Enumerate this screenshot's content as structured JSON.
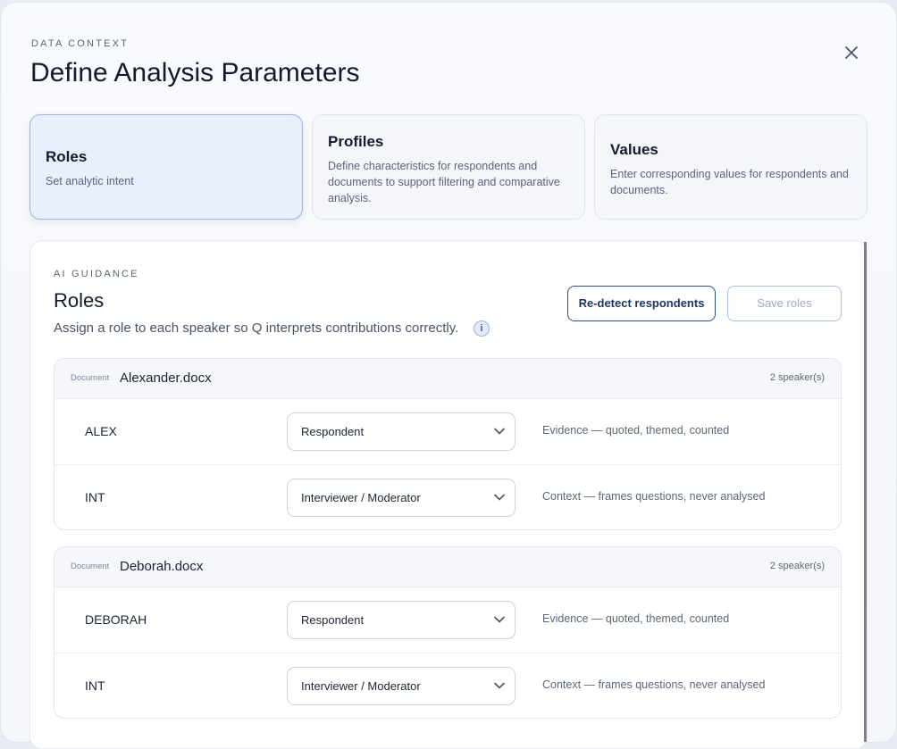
{
  "header": {
    "eyebrow": "DATA CONTEXT",
    "title": "Define Analysis Parameters",
    "close_icon": "close-icon"
  },
  "steps": [
    {
      "title": "Roles",
      "description": "Set analytic intent",
      "active": true
    },
    {
      "title": "Profiles",
      "description": "Define characteristics for respondents and documents to support filtering and comparative analysis.",
      "active": false
    },
    {
      "title": "Values",
      "description": "Enter corresponding values for respondents and documents.",
      "active": false
    }
  ],
  "panel": {
    "eyebrow": "AI GUIDANCE",
    "title": "Roles",
    "subtitle": "Assign a role to each speaker so Q interprets contributions correctly.",
    "info_icon": "i",
    "redetect_label": "Re-detect respondents",
    "save_label": "Save roles"
  },
  "documents": [
    {
      "tag": "Document",
      "name": "Alexander.docx",
      "count": "2 speaker(s)",
      "rows": [
        {
          "speaker": "ALEX",
          "role": "Respondent",
          "hint": "Evidence — quoted, themed, counted"
        },
        {
          "speaker": "INT",
          "role": "Interviewer / Moderator",
          "hint": "Context — frames questions, never analysed"
        }
      ]
    },
    {
      "tag": "Document",
      "name": "Deborah.docx",
      "count": "2 speaker(s)",
      "rows": [
        {
          "speaker": "DEBORAH",
          "role": "Respondent",
          "hint": "Evidence — quoted, themed, counted"
        },
        {
          "speaker": "INT",
          "role": "Interviewer / Moderator",
          "hint": "Context — frames questions, never analysed"
        }
      ]
    }
  ],
  "colors": {
    "accent": "#2f4e86",
    "active_step_bg": "#e9effc",
    "active_step_border": "#9eb3de"
  }
}
